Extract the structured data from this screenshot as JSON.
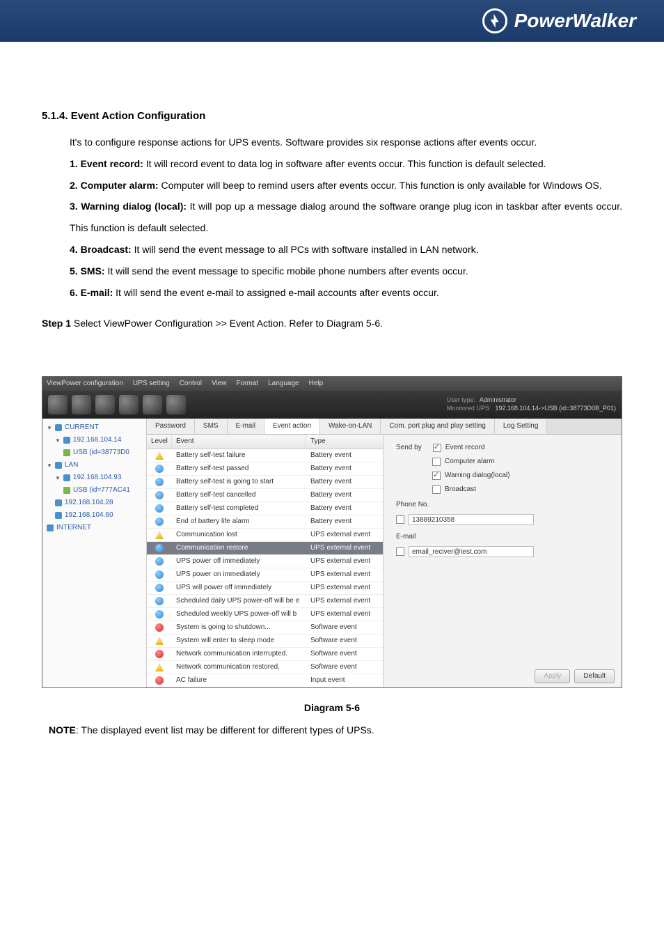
{
  "banner": {
    "brand": "PowerWalker"
  },
  "doc": {
    "section_number": "5.1.4.",
    "section_title": "Event Action Configuration",
    "intro": "It's to configure response actions for UPS events. Software provides six response actions after events occur.",
    "items": [
      {
        "num": "1.",
        "bold": "Event record:",
        "text": " It will record event to data log in software after events occur. This function is default selected."
      },
      {
        "num": "2.",
        "bold": "Computer alarm:",
        "text": " Computer will beep to remind users after events occur. This function is only available for Windows OS."
      },
      {
        "num": "3.",
        "bold": "Warning dialog (local):",
        "text": " It will pop up a message dialog around the software orange plug icon in taskbar after events occur. This function is default selected."
      },
      {
        "num": "4.",
        "bold": "Broadcast:",
        "text": " It will send the event message to all PCs with software installed in LAN network."
      },
      {
        "num": "5.",
        "bold": "SMS:",
        "text": " It will send the event message to specific mobile phone numbers after events occur."
      },
      {
        "num": "6.",
        "bold": "E-mail:",
        "text": " It will send the event e-mail to assigned e-mail accounts after events occur."
      }
    ],
    "step1_bold": "Step 1",
    "step1_text": "  Select ViewPower Configuration >> Event Action. Refer to Diagram 5-6.",
    "caption": "Diagram 5-6",
    "note_bold": "NOTE",
    "note_text": ": The displayed event list may be different for different types of UPSs."
  },
  "app": {
    "menu": [
      "ViewPower configuration",
      "UPS setting",
      "Control",
      "View",
      "Format",
      "Language",
      "Help"
    ],
    "user_type_label": "User type:",
    "user_type_value": "Administrator",
    "monitored_label": "Monitored UPS:",
    "monitored_value": "192.168.104.14->USB (id=38773D0B_P01)",
    "tree": {
      "current": "CURRENT",
      "ip1": "192.168.104.14",
      "usb1": "USB (id=38773D0",
      "lan": "LAN",
      "ip2": "192.168.104.93",
      "usb2": "USB (id=777AC41",
      "ip3": "192.168.104.28",
      "ip4": "192.168.104.60",
      "internet": "INTERNET"
    },
    "tabs": [
      "Password",
      "SMS",
      "E-mail",
      "Event action",
      "Wake-on-LAN",
      "Com. port plug and play setting",
      "Log Setting"
    ],
    "list_headers": {
      "level": "Level",
      "event": "Event",
      "type": "Type"
    },
    "events": [
      {
        "level": "warn",
        "name": "Battery self-test failure",
        "type": "Battery event"
      },
      {
        "level": "info",
        "name": "Battery self-test passed",
        "type": "Battery event"
      },
      {
        "level": "info",
        "name": "Battery self-test is going to start",
        "type": "Battery event"
      },
      {
        "level": "info",
        "name": "Battery self-test cancelled",
        "type": "Battery event"
      },
      {
        "level": "info",
        "name": "Battery self-test completed",
        "type": "Battery event"
      },
      {
        "level": "info",
        "name": "End of battery life alarm",
        "type": "Battery event"
      },
      {
        "level": "warn",
        "name": "Communication lost",
        "type": "UPS external event"
      },
      {
        "level": "info",
        "name": "Communication restore",
        "type": "UPS external event",
        "selected": true
      },
      {
        "level": "info",
        "name": "UPS power off immediately",
        "type": "UPS external event"
      },
      {
        "level": "info",
        "name": "UPS power on immediately",
        "type": "UPS external event"
      },
      {
        "level": "info",
        "name": "UPS will power off immediately",
        "type": "UPS external event"
      },
      {
        "level": "info",
        "name": "Scheduled daily UPS power-off will be e",
        "type": "UPS external event"
      },
      {
        "level": "info",
        "name": "Scheduled weekly UPS power-off will b",
        "type": "UPS external event"
      },
      {
        "level": "err",
        "name": "System is going to shutdown...",
        "type": "Software event"
      },
      {
        "level": "warn",
        "name": "System will enter to sleep mode",
        "type": "Software event"
      },
      {
        "level": "err",
        "name": "Network communication interrupted.",
        "type": "Software event"
      },
      {
        "level": "warn",
        "name": "Network communication restored.",
        "type": "Software event"
      },
      {
        "level": "err",
        "name": "AC failure",
        "type": "Input event"
      }
    ],
    "settings": {
      "send_by_label": "Send by",
      "event_record": "Event record",
      "computer_alarm": "Computer alarm",
      "warning_dialog": "Warning dialog(local)",
      "broadcast": "Broadcast",
      "phone_label": "Phone No.",
      "phone_value": "13889210358",
      "email_label": "E-mail",
      "email_value": "email_reciver@test.com",
      "apply": "Apply",
      "default": "Default"
    }
  }
}
